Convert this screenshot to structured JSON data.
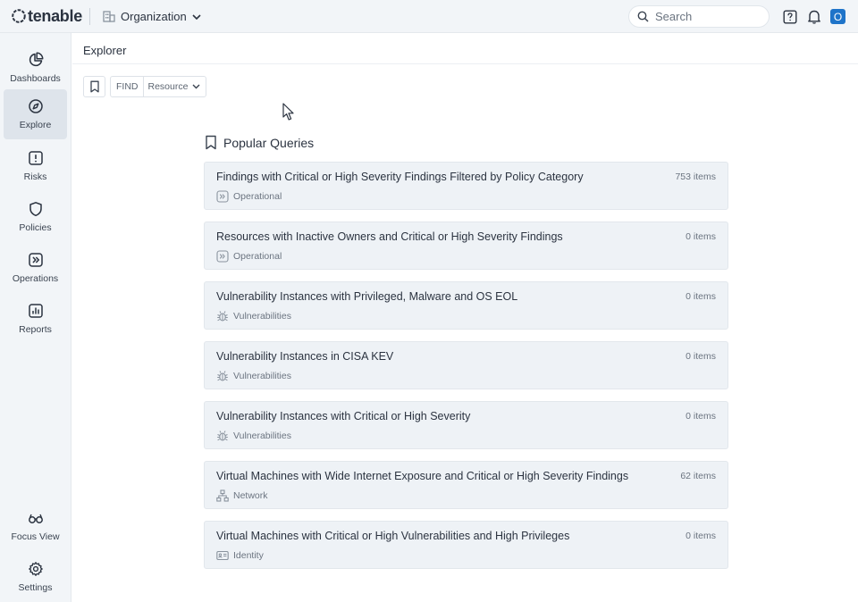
{
  "app": {
    "logo_text": "tenable",
    "org_label": "Organization"
  },
  "search": {
    "placeholder": "Search"
  },
  "sidebar": {
    "items": [
      {
        "label": "Dashboards",
        "icon": "pie-chart-icon",
        "active": false
      },
      {
        "label": "Explore",
        "icon": "compass-icon",
        "active": true
      },
      {
        "label": "Risks",
        "icon": "alert-square-icon",
        "active": false
      },
      {
        "label": "Policies",
        "icon": "shield-icon",
        "active": false
      },
      {
        "label": "Operations",
        "icon": "chevrons-square-icon",
        "active": false
      },
      {
        "label": "Reports",
        "icon": "bar-chart-icon",
        "active": false
      }
    ],
    "bottom_items": [
      {
        "label": "Focus View",
        "icon": "glasses-icon"
      },
      {
        "label": "Settings",
        "icon": "gear-icon"
      }
    ]
  },
  "page": {
    "title": "Explorer"
  },
  "find": {
    "label": "FIND",
    "selected": "Resource"
  },
  "popular_queries": {
    "title": "Popular Queries",
    "items": [
      {
        "title": "Findings with Critical or High Severity Findings Filtered by Policy Category",
        "count": "753 items",
        "category": "Operational",
        "icon": "operational-icon"
      },
      {
        "title": "Resources with Inactive Owners and Critical or High Severity Findings",
        "count": "0 items",
        "category": "Operational",
        "icon": "operational-icon"
      },
      {
        "title": "Vulnerability Instances with Privileged, Malware and OS EOL",
        "count": "0 items",
        "category": "Vulnerabilities",
        "icon": "bug-icon"
      },
      {
        "title": "Vulnerability Instances in CISA KEV",
        "count": "0 items",
        "category": "Vulnerabilities",
        "icon": "bug-icon"
      },
      {
        "title": "Vulnerability Instances with Critical or High Severity",
        "count": "0 items",
        "category": "Vulnerabilities",
        "icon": "bug-icon"
      },
      {
        "title": "Virtual Machines with Wide Internet Exposure and Critical or High Severity Findings",
        "count": "62 items",
        "category": "Network",
        "icon": "network-icon"
      },
      {
        "title": "Virtual Machines with Critical or High Vulnerabilities and High Privileges",
        "count": "0 items",
        "category": "Identity",
        "icon": "id-card-icon"
      }
    ]
  },
  "user": {
    "initial": "O"
  },
  "colors": {
    "accent": "#1f74c9",
    "sidebar_bg": "#f2f5f8",
    "card_bg": "#eef2f6"
  }
}
